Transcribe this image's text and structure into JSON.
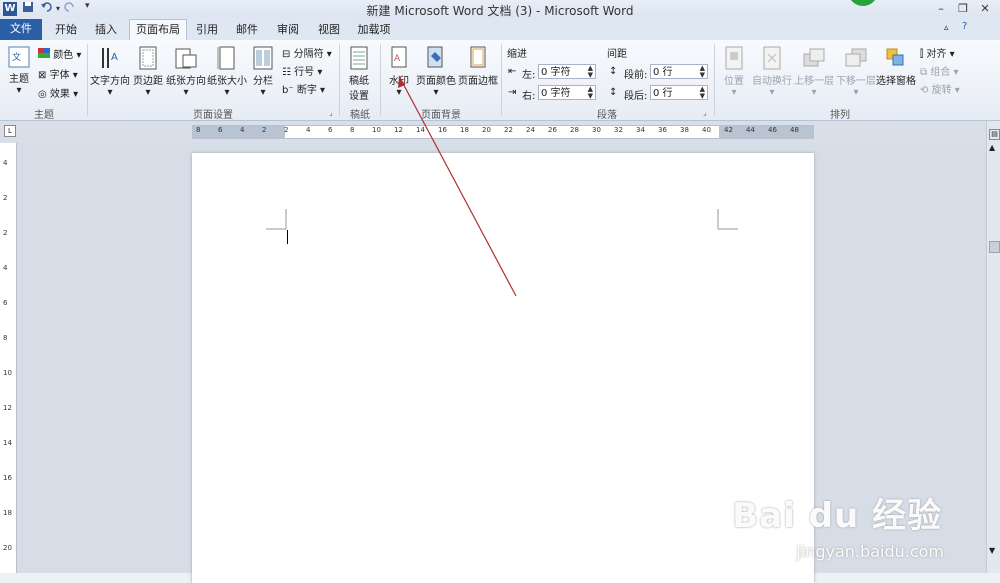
{
  "app": {
    "title": "新建 Microsoft Word 文档 (3)  -  Microsoft Word",
    "word_icon": "W"
  },
  "quick_access": {
    "save_icon": "save-icon",
    "undo_icon": "undo-icon",
    "redo_icon": "redo-icon"
  },
  "tabs": [
    {
      "label": "文件"
    },
    {
      "label": "开始"
    },
    {
      "label": "插入"
    },
    {
      "label": "页面布局"
    },
    {
      "label": "引用"
    },
    {
      "label": "邮件"
    },
    {
      "label": "审阅"
    },
    {
      "label": "视图"
    },
    {
      "label": "加载项"
    }
  ],
  "ribbon": {
    "themes": {
      "group_label": "主题",
      "theme": "主题",
      "colors": "颜色",
      "fonts": "字体",
      "effects": "效果"
    },
    "page_setup": {
      "group_label": "页面设置",
      "text_direction": "文字方向",
      "margins": "页边距",
      "orientation": "纸张方向",
      "size": "纸张大小",
      "columns": "分栏",
      "breaks": "分隔符",
      "line_numbers": "行号",
      "hyphenation": "断字"
    },
    "manuscript": {
      "group_label": "稿纸",
      "settings_line1": "稿纸",
      "settings_line2": "设置"
    },
    "page_background": {
      "group_label": "页面背景",
      "watermark": "水印",
      "page_color": "页面颜色",
      "page_borders": "页面边框"
    },
    "paragraph": {
      "group_label": "段落",
      "indent_title": "缩进",
      "spacing_title": "间距",
      "left_label": "左:",
      "left_value": "0 字符",
      "right_label": "右:",
      "right_value": "0 字符",
      "before_label": "段前:",
      "before_value": "0 行",
      "after_label": "段后:",
      "after_value": "0 行"
    },
    "arrange": {
      "group_label": "排列",
      "position": "位置",
      "wrap_text": "自动换行",
      "bring_forward": "上移一层",
      "send_backward": "下移一层",
      "selection_pane": "选择窗格",
      "align": "对齐",
      "group": "组合",
      "rotate": "旋转"
    }
  },
  "ruler": {
    "h_numbers": [
      "8",
      "6",
      "4",
      "2",
      "2",
      "4",
      "6",
      "8",
      "10",
      "12",
      "14",
      "16",
      "18",
      "20",
      "22",
      "24",
      "26",
      "28",
      "30",
      "32",
      "34",
      "36",
      "38",
      "40",
      "42",
      "44",
      "46",
      "48"
    ],
    "v_numbers": [
      "4",
      "2",
      "2",
      "4",
      "6",
      "8",
      "10",
      "12",
      "14",
      "16",
      "18",
      "20"
    ]
  },
  "watermark_text": {
    "brand": "Bai du 经验",
    "url": "jingyan.baidu.com"
  },
  "colors": {
    "file_tab": "#2a5fa8",
    "annotation_arrow": "#b03030"
  }
}
